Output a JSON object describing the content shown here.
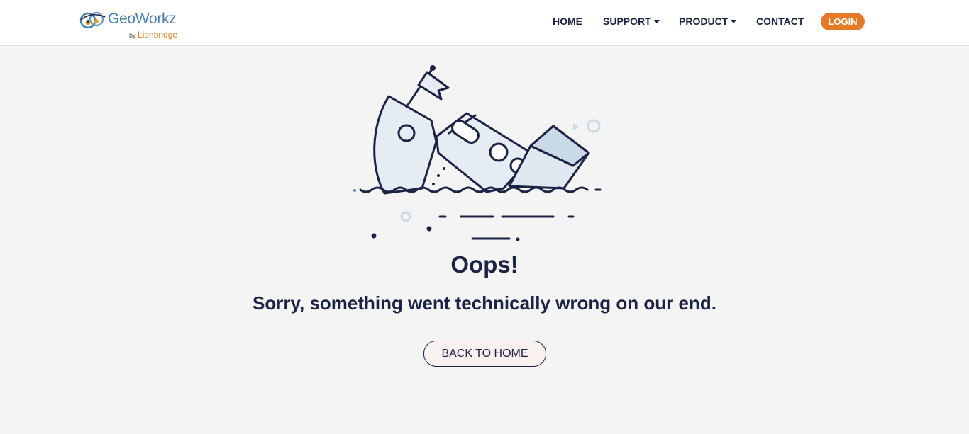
{
  "header": {
    "logo": {
      "name": "GeoWorkz",
      "by": "by",
      "company": "Lionbridge"
    },
    "nav": [
      {
        "label": "HOME",
        "has_dropdown": false
      },
      {
        "label": "SUPPORT",
        "has_dropdown": true
      },
      {
        "label": "PRODUCT",
        "has_dropdown": true
      },
      {
        "label": "CONTACT",
        "has_dropdown": false
      }
    ],
    "login_label": "LOGIN"
  },
  "error": {
    "title": "Oops!",
    "message": "Sorry, something went technically wrong on our end.",
    "back_button": "BACK TO HOME"
  },
  "colors": {
    "navy": "#1b2244",
    "accent_orange": "#e57a26",
    "page_bg": "#f4f4f4",
    "ship_fill": "#e6ecf3",
    "ship_highlight": "#c9d9e8"
  },
  "icons": {
    "logo_mark": "globe-pin-logo-icon",
    "caret": "caret-down-icon",
    "illustration": "sinking-ship-illustration"
  }
}
